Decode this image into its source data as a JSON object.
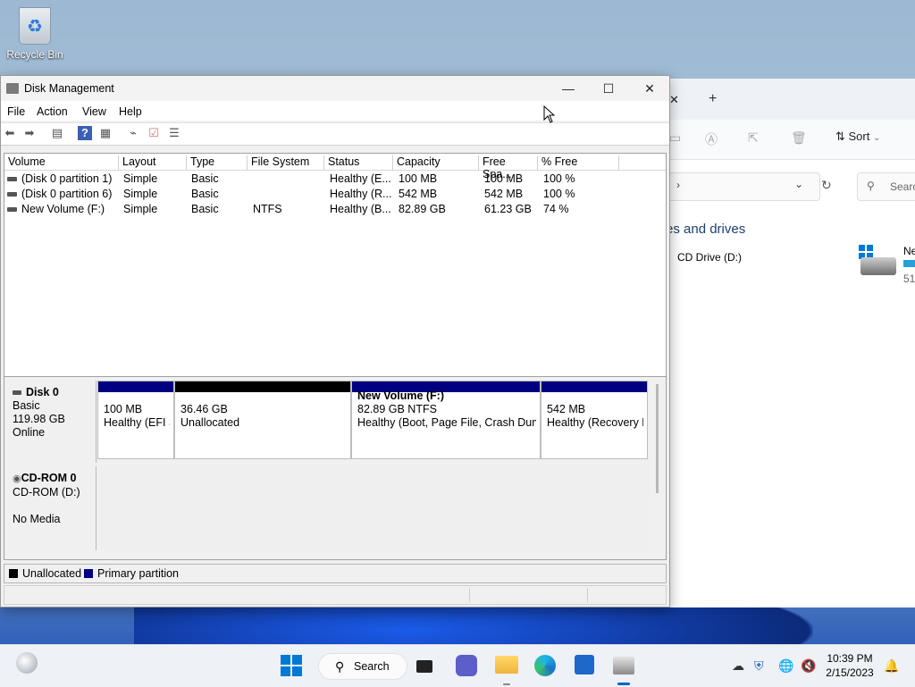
{
  "desktop": {
    "recycle_bin_label": "Recycle Bin"
  },
  "explorer": {
    "sort_label": "Sort",
    "search_placeholder": "Searc",
    "section_title": "es and drives",
    "cd_drive_label": "CD Drive (D:)",
    "drive_label_partial": "Ne",
    "drive_size_partial": "51"
  },
  "window": {
    "title": "Disk Management",
    "menu": [
      "File",
      "Action",
      "View",
      "Help"
    ]
  },
  "volume_list": {
    "columns": [
      "Volume",
      "Layout",
      "Type",
      "File System",
      "Status",
      "Capacity",
      "Free Spa...",
      "% Free"
    ],
    "rows": [
      [
        "(Disk 0 partition 1)",
        "Simple",
        "Basic",
        "",
        "Healthy (E...",
        "100 MB",
        "100 MB",
        "100 %"
      ],
      [
        "(Disk 0 partition 6)",
        "Simple",
        "Basic",
        "",
        "Healthy (R...",
        "542 MB",
        "542 MB",
        "100 %"
      ],
      [
        "New Volume (F:)",
        "Simple",
        "Basic",
        "NTFS",
        "Healthy (B...",
        "82.89 GB",
        "61.23 GB",
        "74 %"
      ]
    ]
  },
  "disks": [
    {
      "name": "Disk 0",
      "lines": [
        "Basic",
        "119.98 GB",
        "Online"
      ],
      "partitions": [
        {
          "title": "",
          "size": "100 MB",
          "status": "Healthy (EFI S",
          "kind": "primary"
        },
        {
          "title": "",
          "size": "36.46 GB",
          "status": "Unallocated",
          "kind": "unallocated"
        },
        {
          "title": "New Volume  (F:)",
          "size": "82.89 GB NTFS",
          "status": "Healthy (Boot, Page File, Crash Dump",
          "kind": "primary"
        },
        {
          "title": "",
          "size": "542 MB",
          "status": "Healthy (Recovery P",
          "kind": "primary"
        }
      ]
    },
    {
      "name": "CD-ROM 0",
      "lines": [
        "CD-ROM (D:)",
        "",
        "No Media"
      ]
    }
  ],
  "legend": [
    {
      "label": "Unallocated",
      "color": "#000000"
    },
    {
      "label": "Primary partition",
      "color": "#000080"
    }
  ],
  "taskbar": {
    "search_label": "Search",
    "time": "10:39 PM",
    "date": "2/15/2023"
  },
  "colors": {
    "primary": "#000080",
    "unallocated": "#000000",
    "accent": "#0067c0"
  }
}
